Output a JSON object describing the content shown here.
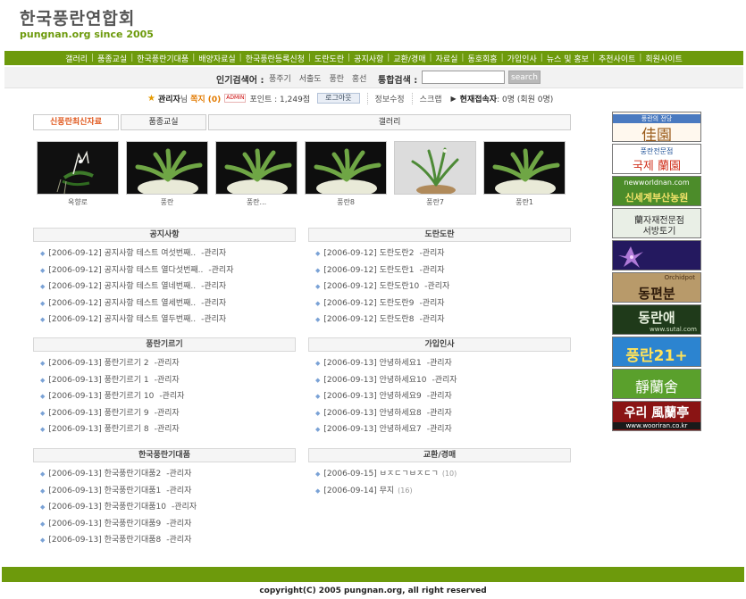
{
  "logo": {
    "title_kr": "한국풍란연합회",
    "subtitle": "pungnan.org since 2005"
  },
  "nav": [
    "갤러리",
    "품종교실",
    "한국풍란기대품",
    "배양자료실",
    "한국풍란등록신청",
    "도란도란",
    "공지사항",
    "교환/경매",
    "자료실",
    "동호회홈",
    "가입인사",
    "뉴스 및 홍보",
    "추천사이트",
    "회원사이트"
  ],
  "search": {
    "popular_label": "인기검색어 :",
    "popular_words": [
      "풍주기",
      "서출도",
      "풍란",
      "홍선"
    ],
    "total_label": "통합검색 :",
    "input_value": "",
    "button_label": "search"
  },
  "user": {
    "name": "관리자",
    "name_suffix": "님",
    "messages": "쪽지 (0)",
    "badge": "ADMIN",
    "points": "포인트 : 1,249점",
    "logout": "로그아웃",
    "edit_info": "정보수정",
    "scrap": "스크랩",
    "connected_label": "현재접속자",
    "connected_value": ": 0명 (회원 0명)"
  },
  "tabs": [
    "신풍란최신자료",
    "품종교실",
    "갤러리"
  ],
  "gallery": [
    "옥향로",
    "풍란",
    "풍란...",
    "풍란8",
    "풍란7",
    "풍란1"
  ],
  "boards": {
    "notice": {
      "title": "공지사항",
      "items": [
        {
          "date": "[2006-09-12]",
          "text": "공지사항 테스트 여섯번째..",
          "author": "-관리자"
        },
        {
          "date": "[2006-09-12]",
          "text": "공지사항 테스트 열다섯번째..",
          "author": "-관리자"
        },
        {
          "date": "[2006-09-12]",
          "text": "공지사항 테스트 열네번째..",
          "author": "-관리자"
        },
        {
          "date": "[2006-09-12]",
          "text": "공지사항 테스트 열세번째..",
          "author": "-관리자"
        },
        {
          "date": "[2006-09-12]",
          "text": "공지사항 테스트 열두번째..",
          "author": "-관리자"
        }
      ]
    },
    "doran": {
      "title": "도란도란",
      "items": [
        {
          "date": "[2006-09-12]",
          "text": "도란도란2",
          "author": "-관리자"
        },
        {
          "date": "[2006-09-12]",
          "text": "도란도란1",
          "author": "-관리자"
        },
        {
          "date": "[2006-09-12]",
          "text": "도란도란10",
          "author": "-관리자"
        },
        {
          "date": "[2006-09-12]",
          "text": "도란도란9",
          "author": "-관리자"
        },
        {
          "date": "[2006-09-12]",
          "text": "도란도란8",
          "author": "-관리자"
        }
      ]
    },
    "diary": {
      "title": "풍란기르기",
      "items": [
        {
          "date": "[2006-09-13]",
          "text": "풍란기르기 2",
          "author": "-관리자"
        },
        {
          "date": "[2006-09-13]",
          "text": "풍란기르기 1",
          "author": "-관리자"
        },
        {
          "date": "[2006-09-13]",
          "text": "풍란기르기 10",
          "author": "-관리자"
        },
        {
          "date": "[2006-09-13]",
          "text": "풍란기르기 9",
          "author": "-관리자"
        },
        {
          "date": "[2006-09-13]",
          "text": "풍란기르기 8",
          "author": "-관리자"
        }
      ]
    },
    "greet": {
      "title": "가입인사",
      "items": [
        {
          "date": "[2006-09-13]",
          "text": "안녕하세요1",
          "author": "-관리자"
        },
        {
          "date": "[2006-09-13]",
          "text": "안녕하세요10",
          "author": "-관리자"
        },
        {
          "date": "[2006-09-13]",
          "text": "안녕하세요9",
          "author": "-관리자"
        },
        {
          "date": "[2006-09-13]",
          "text": "안녕하세요8",
          "author": "-관리자"
        },
        {
          "date": "[2006-09-13]",
          "text": "안녕하세요7",
          "author": "-관리자"
        }
      ]
    },
    "expected": {
      "title": "한국풍란기대품",
      "items": [
        {
          "date": "[2006-09-13]",
          "text": "한국풍란기대품2",
          "author": "-관리자"
        },
        {
          "date": "[2006-09-13]",
          "text": "한국풍란기대품1",
          "author": "-관리자"
        },
        {
          "date": "[2006-09-13]",
          "text": "한국풍란기대품10",
          "author": "-관리자"
        },
        {
          "date": "[2006-09-13]",
          "text": "한국풍란기대품9",
          "author": "-관리자"
        },
        {
          "date": "[2006-09-13]",
          "text": "한국풍란기대품8",
          "author": "-관리자"
        }
      ]
    },
    "trade": {
      "title": "교환/경매",
      "items": [
        {
          "date": "[2006-09-15]",
          "text": "ㅂㅈㄷㄱㅂㅈㄷㄱ",
          "count": "(10)"
        },
        {
          "date": "[2006-09-14]",
          "text": "무지",
          "count": "(16)"
        }
      ]
    }
  },
  "banners": [
    {
      "top": "풍란의 전당",
      "main": "佳園"
    },
    {
      "top": "풍란전문점",
      "main": "국제 蘭園"
    },
    {
      "top": "newworldnan.com",
      "main": "신세계부산농원"
    },
    {
      "top": "",
      "main": "蘭자재전문점 서방토기"
    },
    {
      "top": "",
      "main": ""
    },
    {
      "top": "Orchidpot",
      "main": "동편분"
    },
    {
      "top": "www.sutal.com",
      "main": "동란애"
    },
    {
      "top": "",
      "main": "풍란21+"
    },
    {
      "top": "",
      "main": "靜蘭舍"
    },
    {
      "top": "www.wooriran.co.kr",
      "main": "우리 風蘭亭"
    }
  ],
  "footer": {
    "copyright": "copyright(C) 2005 pungnan.org, all right reserved"
  },
  "colors": {
    "brand_green": "#6d9a0c",
    "tab_active": "#e0581d",
    "message": "#e27a00"
  }
}
